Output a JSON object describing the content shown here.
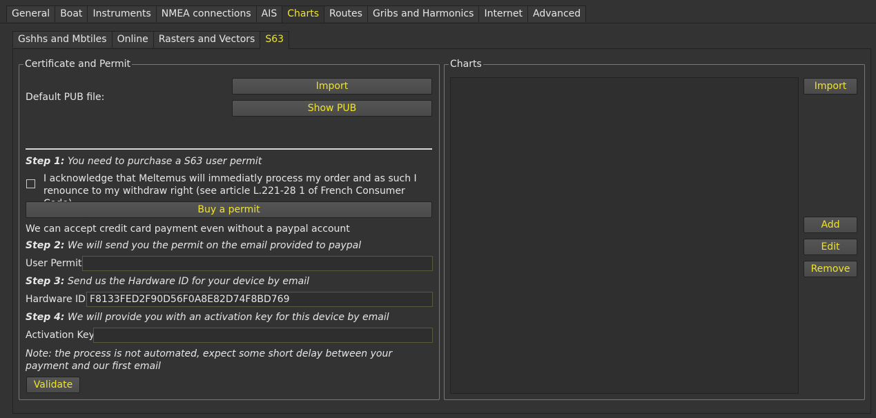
{
  "top_tabs": [
    "General",
    "Boat",
    "Instruments",
    "NMEA connections",
    "AIS",
    "Charts",
    "Routes",
    "Gribs and Harmonics",
    "Internet",
    "Advanced"
  ],
  "sub_tabs": [
    "Gshhs and Mbtiles",
    "Online",
    "Rasters and Vectors",
    "S63"
  ],
  "certificate": {
    "title": "Certificate and Permit",
    "default_pub_label": "Default PUB file:",
    "import_label": "Import",
    "show_pub_label": "Show PUB",
    "step1_bold": "Step 1:",
    "step1_text": " You need to purchase a S63 user permit",
    "acknowledge_text": "I acknowledge that Meltemus will immediatly process my order and as such I renounce to my withdraw right (see article L.221-28 1 of French Consumer Code)",
    "buy_permit_label": "Buy a permit",
    "credit_card_text": "We can accept credit card payment even without a paypal account",
    "step2_bold": "Step 2:",
    "step2_text": " We will send you the permit on the email provided to paypal",
    "user_permit_label": "User Permit",
    "user_permit_value": "",
    "step3_bold": "Step 3:",
    "step3_text": " Send us the Hardware ID for your device by email",
    "hardware_id_label": "Hardware ID",
    "hardware_id_value": "F8133FED2F90D56F0A8E82D74F8BD769",
    "step4_bold": "Step 4:",
    "step4_text": " We will provide you with an activation key for this device by email",
    "activation_key_label": "Activation Key",
    "activation_key_value": "",
    "note_text": "Note: the process is not automated, expect some short delay between your payment and our first email",
    "validate_label": "Validate"
  },
  "charts": {
    "title": "Charts",
    "import_label": "Import",
    "add_label": "Add",
    "edit_label": "Edit",
    "remove_label": "Remove"
  },
  "colors": {
    "background": "#333333",
    "accent": "#f0e42a",
    "text": "#e6e6e6"
  }
}
